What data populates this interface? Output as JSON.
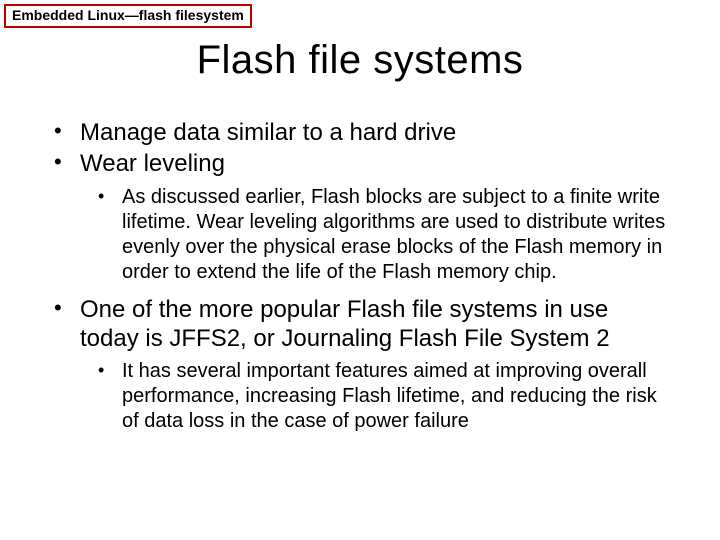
{
  "header": {
    "badge": "Embedded Linux—flash filesystem"
  },
  "title": "Flash file systems",
  "bullets": {
    "b1": "Manage data similar to a hard drive",
    "b2": "Wear leveling",
    "b2_1": "As discussed earlier, Flash blocks are subject to a finite write lifetime. Wear leveling algorithms are used to distribute writes evenly over the physical erase blocks of the Flash memory in order to extend the life of the Flash memory chip.",
    "b3": "One of the more popular Flash file systems in use today is JFFS2, or Journaling Flash File System 2",
    "b3_1": "It has several important features aimed at improving overall performance, increasing Flash lifetime, and reducing the risk of data loss in the case of power failure"
  }
}
